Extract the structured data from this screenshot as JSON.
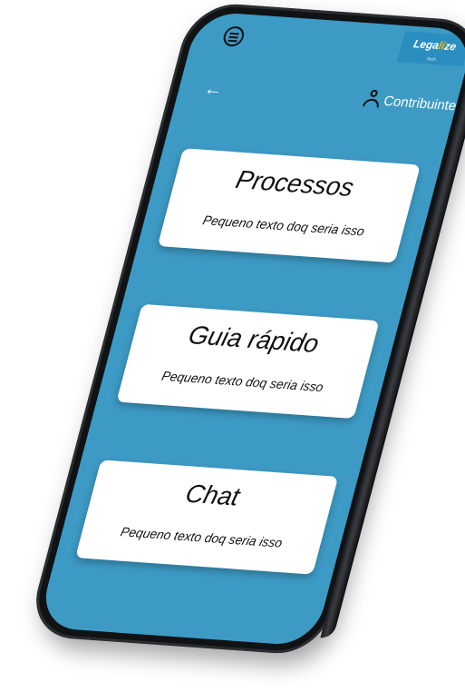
{
  "app": {
    "brand_name_prefix": "Lega",
    "brand_name_mid": "li",
    "brand_name_suffix": "ze",
    "brand_tagline": "Tech",
    "brand_color": "#2b8ec0",
    "background_color": "#3d9ac4"
  },
  "header": {
    "menu_icon": "menu-circle-icon",
    "back_icon": "arrow-left-icon",
    "back_glyph": "←",
    "user_icon": "user-icon",
    "user_label": "Contribuinte"
  },
  "cards": [
    {
      "title": "Processos",
      "description": "Pequeno texto doq seria isso"
    },
    {
      "title": "Guia rápido",
      "description": "Pequeno texto doq seria isso"
    },
    {
      "title": "Chat",
      "description": "Pequeno texto doq seria isso"
    }
  ]
}
